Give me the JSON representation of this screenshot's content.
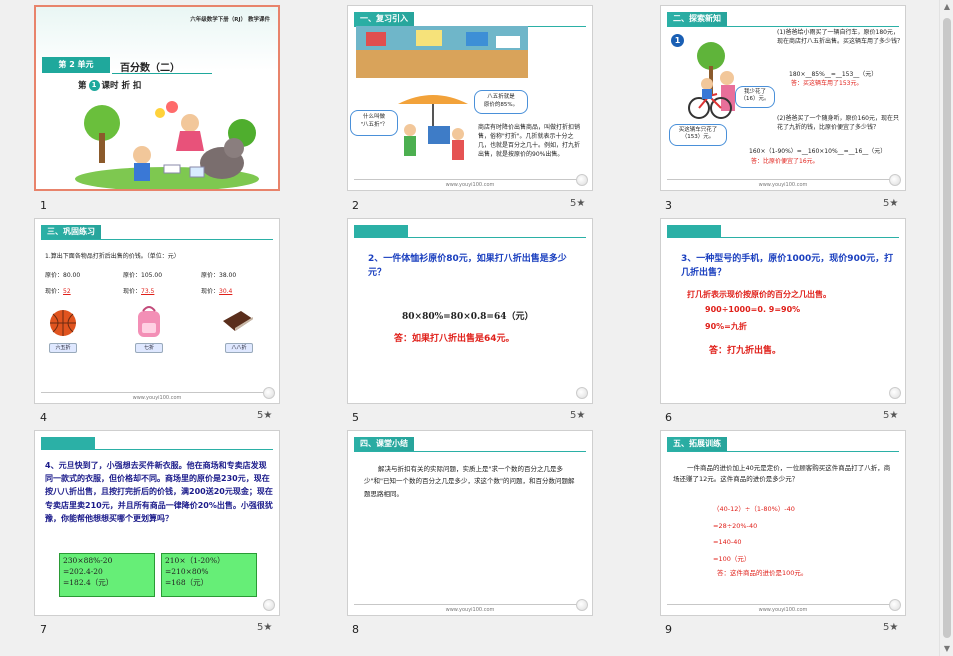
{
  "slides": [
    {
      "num": "1",
      "top_right": "六年级数学下册（RJ）   教学课件",
      "unit_label": "第 2 单元",
      "unit_title": "百分数（二）",
      "lesson_prefix": "第",
      "lesson_num": "1",
      "lesson_suffix": "课时  折 扣"
    },
    {
      "num": "2",
      "header": "一、复习引入",
      "bubble_left": "什么叫做\n\"八五折\"？",
      "bubble_right": "八五折就是\n原价的85%。",
      "body": "商店有时降价出售商品，叫做打折扣销售，俗称\"打折\"。几折就表示十分之几，也就是百分之几十。例如，打九折出售，就是按原价的90%出售。",
      "url": "www.youyi100.com",
      "star": "5★"
    },
    {
      "num": "3",
      "header": "二、探索新知",
      "num_badge": "1",
      "q1": "(1)爸爸给小雨买了一辆自行车，原价180元，现在商店打八五折出售。买这辆车用了多少钱？",
      "calc1": "180×__85%__=__153__（元）",
      "ans1": "答：买这辆车用了153元。",
      "q2": "(2)爸爸买了一个随身听，原价160元，现在只花了九折的钱，比原价便宜了多少钱？",
      "calc2": "160×（1-90%）=__160×10%__=__16__（元）",
      "ans2": "答：比原价便宜了16元。",
      "bubble_a": "买这辆车只花了（153）元。",
      "bubble_b": "我少花了（16）元。",
      "url": "www.youyi100.com",
      "star": "5★"
    },
    {
      "num": "4",
      "header": "三、巩固练习",
      "prompt": "1.算出下面各物品打折后出售的价钱。（单位：元）",
      "orig_label": "原价：",
      "now_label": "现价：",
      "items": [
        {
          "orig": "80.00",
          "now": "52",
          "badge": "六五折"
        },
        {
          "orig": "105.00",
          "now": "73.5",
          "badge": "七折"
        },
        {
          "orig": "38.00",
          "now": "30.4",
          "badge": "八八折"
        }
      ],
      "url": "www.youyi100.com",
      "star": "5★"
    },
    {
      "num": "5",
      "question": "2、一件体恤衫原价80元，如果打八折出售是多少元？",
      "calc": "80×80%=80×0.8=64（元）",
      "answer": "答：如果打八折出售是64元。",
      "star": "5★"
    },
    {
      "num": "6",
      "question": "3、一种型号的手机，原价1000元，现价900元，打几折出售？",
      "line1": "打几折表示现价按原价的百分之几出售。",
      "line2": "900÷1000=0. 9=90%",
      "line3": "90%=九折",
      "answer": "答：打九折出售。",
      "star": "5★"
    },
    {
      "num": "7",
      "question": "4、元旦快到了，小强想去买件新衣服。他在商场和专卖店发现同一款式的衣服，但价格却不同。商场里的原价是230元，现在按八八折出售，且按打完折后的价钱，满200送20元现金；现在专卖店里卖210元，并且所有商品一律降价20%出售。小强很犹豫，你能帮他想想买哪个更划算吗？",
      "box1": [
        "230×88%-20",
        "=202.4-20",
        "=182.4（元）"
      ],
      "box2": [
        "210×（1-20%）",
        "=210×80%",
        "=168（元）"
      ],
      "star": "5★"
    },
    {
      "num": "8",
      "header": "四、课堂小结",
      "body": "解决与折扣有关的实际问题，实质上是\"求一个数的百分之几是多少\"和\"已知一个数的百分之几是多少，求这个数\"的问题，和百分数问题解题思路相同。",
      "url": "www.youyi100.com"
    },
    {
      "num": "9",
      "header": "五、拓展训练",
      "body": "一件商品的进价加上40元是定价，一位顾客购买这件商品打了八折，商场还赚了12元。这件商品的进价是多少元？",
      "lines": [
        "（40-12）÷（1-80%）-40",
        "=28÷20%-40",
        "=140-40",
        "=100（元）"
      ],
      "answer": "答：这件商品的进价是100元。",
      "url": "www.youyi100.com",
      "star": "5★"
    }
  ],
  "colors": {
    "accent": "#2bb0a6",
    "selected_border": "#e8836b",
    "red": "#e0201a",
    "blue": "#1a3fbf",
    "green_box": "#66ee77"
  }
}
